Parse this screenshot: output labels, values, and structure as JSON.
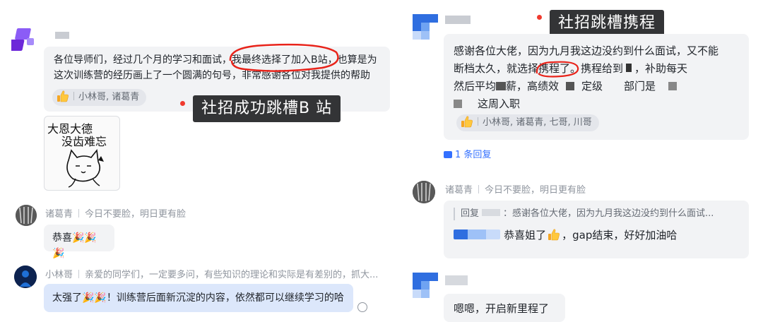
{
  "left_chat": {
    "msg1": {
      "text_part1": "各位导师们，经过几个月的学习和面试，",
      "text_highlight": "我最终选择了加入B站",
      "text_part2": "，也算是为这次训练营的经历画上了一个圆满的句号，非常感谢各位对我提供的帮助",
      "reaction_names": "小林哥, 诸葛青",
      "sticker": {
        "line1": "大恩大德",
        "line2": "没齿难忘"
      }
    },
    "annotation": "社招成功跳槽B 站",
    "reply1": {
      "name": "诸葛青",
      "status": "今日不要脸，明日更有脸",
      "text": "恭喜"
    },
    "reply2": {
      "name": "小林哥",
      "status": "亲爱的同学们，一定要多问，有些知识的理论和实际是有差别的，抓大...",
      "text_a": "太强了",
      "text_b": "！训练营后面新沉淀的内容，依然都可以继续学习的哈"
    }
  },
  "right_chat": {
    "annotation": "社招跳槽携程",
    "msg1": {
      "line1": "感谢各位大佬，因为九月我这边没约到什么面试，又不能",
      "line2a": "断档太久，就选择",
      "line2_highlight": "携程了",
      "line2b": "。携程给到",
      "line2c": "，补助每天",
      "line3a": "然后平均",
      "line3b": "薪，高绩效",
      "line3c": "定级",
      "line3d": "部门是",
      "line4": "这周入职",
      "reaction_names": "小林哥, 诸葛青, 七哥, 川哥",
      "reply_count": "1 条回复"
    },
    "reply1": {
      "name": "诸葛青",
      "status": "今日不要脸，明日更有脸",
      "quote_prefix": "回复",
      "quote_text": "：感谢各位大佬，因为九月我这边没约到什么面试...",
      "text_a": "恭喜姐了",
      "text_b": "，gap结束，好好加油哈"
    },
    "msg2": {
      "text": "嗯嗯，开启新里程了"
    }
  },
  "colors": {
    "annotation_bg": "#333436",
    "red_dot": "#f03a2e",
    "bubble_bg": "#f2f3f5",
    "reply_blue": "#dce7fb",
    "link_blue": "#3370ff"
  }
}
